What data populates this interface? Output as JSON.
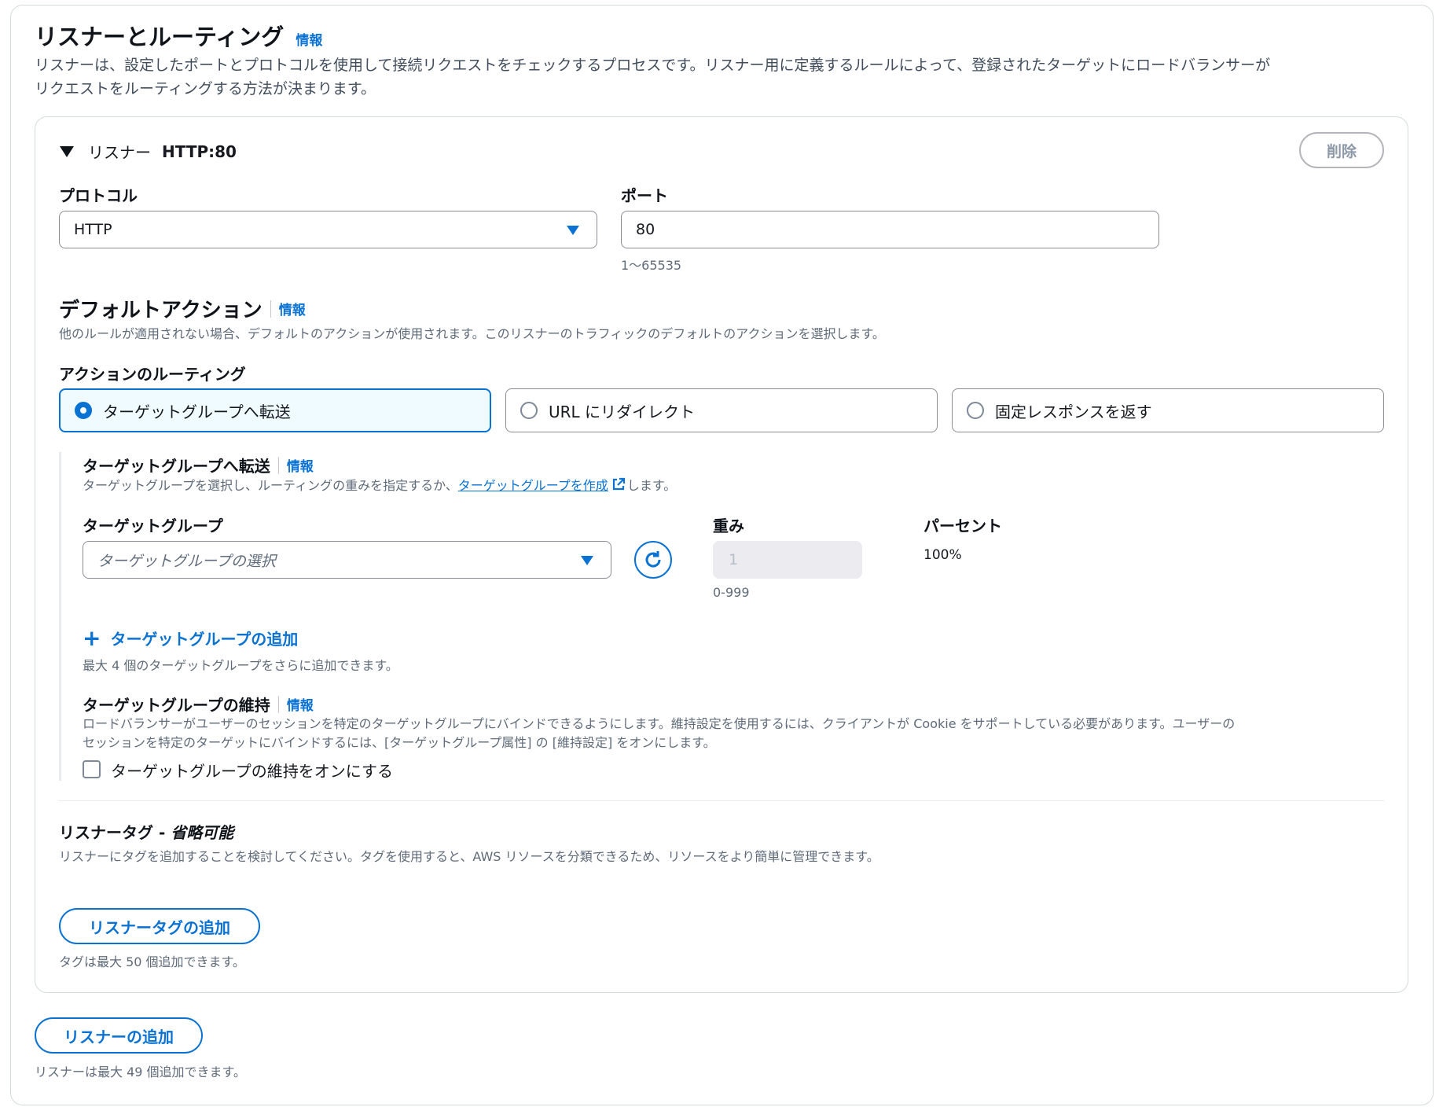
{
  "section": {
    "title": "リスナーとルーティング",
    "info_label": "情報",
    "description_line1": "リスナーは、設定したポートとプロトコルを使用して接続リクエストをチェックするプロセスです。リスナー用に定義するルールによって、登録されたターゲットにロードバランサーが",
    "description_line2": "リクエストをルーティングする方法が決まります。"
  },
  "listener": {
    "header_prefix": "リスナー",
    "header_name": "HTTP:80",
    "delete_label": "削除",
    "protocol": {
      "label": "プロトコル",
      "value": "HTTP"
    },
    "port": {
      "label": "ポート",
      "value": "80",
      "hint": "1〜65535"
    }
  },
  "default_action": {
    "title": "デフォルトアクション",
    "info_label": "情報",
    "description": "他のルールが適用されない場合、デフォルトのアクションが使用されます。このリスナーのトラフィックのデフォルトのアクションを選択します。",
    "routing_label": "アクションのルーティング",
    "options": [
      {
        "label": "ターゲットグループへ転送",
        "selected": true
      },
      {
        "label": "URL にリダイレクト",
        "selected": false
      },
      {
        "label": "固定レスポンスを返す",
        "selected": false
      }
    ]
  },
  "forward": {
    "title": "ターゲットグループへ転送",
    "info_label": "情報",
    "desc_before": "ターゲットグループを選択し、ルーティングの重みを指定するか、",
    "desc_link": "ターゲットグループを作成",
    "desc_after": "します。",
    "target_group_label": "ターゲットグループ",
    "target_group_placeholder": "ターゲットグループの選択",
    "weight_label": "重み",
    "weight_value": "1",
    "weight_hint": "0-999",
    "percent_label": "パーセント",
    "percent_value": "100%",
    "add_target_group_label": "ターゲットグループの追加",
    "add_target_group_hint": "最大 4 個のターゲットグループをさらに追加できます。"
  },
  "stickiness": {
    "title": "ターゲットグループの維持",
    "info_label": "情報",
    "description_line1": "ロードバランサーがユーザーのセッションを特定のターゲットグループにバインドできるようにします。維持設定を使用するには、クライアントが Cookie をサポートしている必要があります。ユーザーの",
    "description_line2": "セッションを特定のターゲットにバインドするには、[ターゲットグループ属性] の [維持設定] をオンにします。",
    "checkbox_label": "ターゲットグループの維持をオンにする",
    "checked": false
  },
  "tags": {
    "title": "リスナータグ - ",
    "title_optional": "省略可能",
    "description": "リスナーにタグを追加することを検討してください。タグを使用すると、AWS リソースを分類できるため、リソースをより簡単に管理できます。",
    "add_button": "リスナータグの追加",
    "hint": "タグは最大 50 個追加できます。"
  },
  "add_listener": {
    "button": "リスナーの追加",
    "hint": "リスナーは最大 49 個追加できます。"
  },
  "colors": {
    "accent": "#0972d3",
    "selected_bg": "#f0fbff",
    "text": "#0f141a",
    "muted": "#5f6b7a"
  },
  "icons": [
    "caret-down-icon",
    "dropdown-caret-icon",
    "refresh-icon",
    "external-link-icon",
    "plus-icon"
  ]
}
